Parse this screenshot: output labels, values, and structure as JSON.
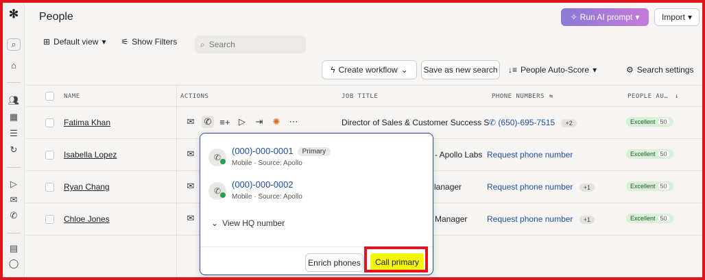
{
  "app": {
    "title": "People"
  },
  "header": {
    "run_ai_label": "Run AI prompt",
    "import_label": "Import"
  },
  "toolbar": {
    "default_view_label": "Default view",
    "show_filters_label": "Show Filters",
    "search_placeholder": "Search",
    "create_workflow_label": "Create workflow",
    "save_search_label": "Save as new search",
    "auto_score_label": "People Auto-Score",
    "search_settings_label": "Search settings"
  },
  "table": {
    "columns": [
      "NAME",
      "ACTIONS",
      "JOB TITLE",
      "PHONE NUMBERS",
      "PEOPLE AU…"
    ],
    "rows": [
      {
        "name": "Fatima Khan",
        "job_title": "Director of Sales & Customer Success S",
        "phone": "(650)-695-7515",
        "phone_extra": "+2",
        "score": "Excellent",
        "score_num": "50"
      },
      {
        "name": "Isabella Lopez",
        "job_title": "- Apollo Labs",
        "phone": "Request phone number",
        "phone_extra": "",
        "score": "Excellent",
        "score_num": "50"
      },
      {
        "name": "Ryan Chang",
        "job_title": "lanager",
        "phone": "Request phone number",
        "phone_extra": "+1",
        "score": "Excellent",
        "score_num": "50"
      },
      {
        "name": "Chloe Jones",
        "job_title": "Manager",
        "phone": "Request phone number",
        "phone_extra": "+1",
        "score": "Excellent",
        "score_num": "50"
      }
    ]
  },
  "popup": {
    "phones": [
      {
        "number": "(000)-000-0001",
        "tag": "Primary",
        "sub": "Mobile · Source: Apollo"
      },
      {
        "number": "(000)-000-0002",
        "tag": "",
        "sub": "Mobile · Source: Apollo"
      }
    ],
    "view_hq_label": "View HQ number",
    "enrich_label": "Enrich phones",
    "call_label": "Call primary"
  },
  "colors": {
    "highlight": "#e0141e",
    "call_button": "#f3f60a",
    "link": "#1f4fa0"
  },
  "icons": [
    "logo-icon",
    "search-icon",
    "home-icon",
    "people-icon",
    "building-icon",
    "list-icon",
    "refresh-icon",
    "send-icon",
    "mail-icon",
    "phone-icon",
    "calendar-icon",
    "chat-icon",
    "sparkle-icon",
    "table-icon",
    "filter-icon",
    "bolt-icon",
    "sort-icon",
    "gear-icon",
    "checkmail-icon",
    "task-icon",
    "plus-icon",
    "more-icon"
  ]
}
